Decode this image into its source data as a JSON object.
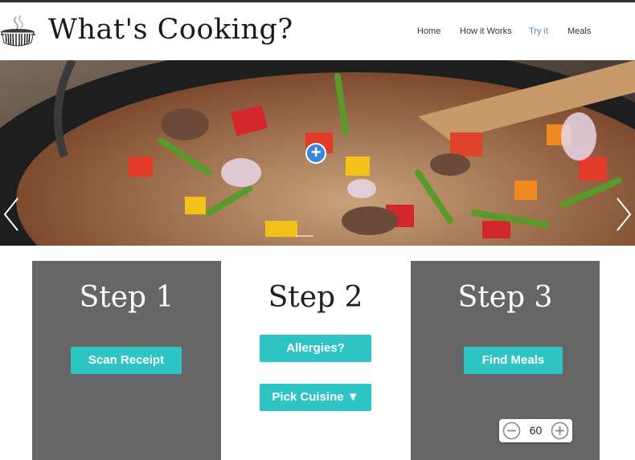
{
  "header": {
    "brand": "What's Cooking?",
    "logo_icon": "steaming-pot-barcode-icon",
    "nav": [
      {
        "label": "Home",
        "active": false
      },
      {
        "label": "How it Works",
        "active": false
      },
      {
        "label": "Try it",
        "active": true
      },
      {
        "label": "Meals",
        "active": false
      }
    ]
  },
  "hero": {
    "image": "stir-fry-vegetables-in-wok",
    "prev_icon": "chevron-left-icon",
    "next_icon": "chevron-right-icon",
    "add_icon": "plus-circle-icon"
  },
  "steps": [
    {
      "title": "Step 1",
      "buttons": [
        "Scan Receipt"
      ]
    },
    {
      "title": "Step 2",
      "buttons": [
        "Allergies?",
        "Pick Cuisine ▼"
      ]
    },
    {
      "title": "Step 3",
      "buttons": [
        "Find Meals"
      ]
    }
  ],
  "zoom": {
    "value": "60",
    "minus_icon": "zoom-out-icon",
    "plus_icon": "zoom-in-icon"
  },
  "colors": {
    "accent": "#2ec4c3",
    "panel": "#666666",
    "nav_active": "#4a8fd8",
    "add_button": "#3b86e0"
  }
}
